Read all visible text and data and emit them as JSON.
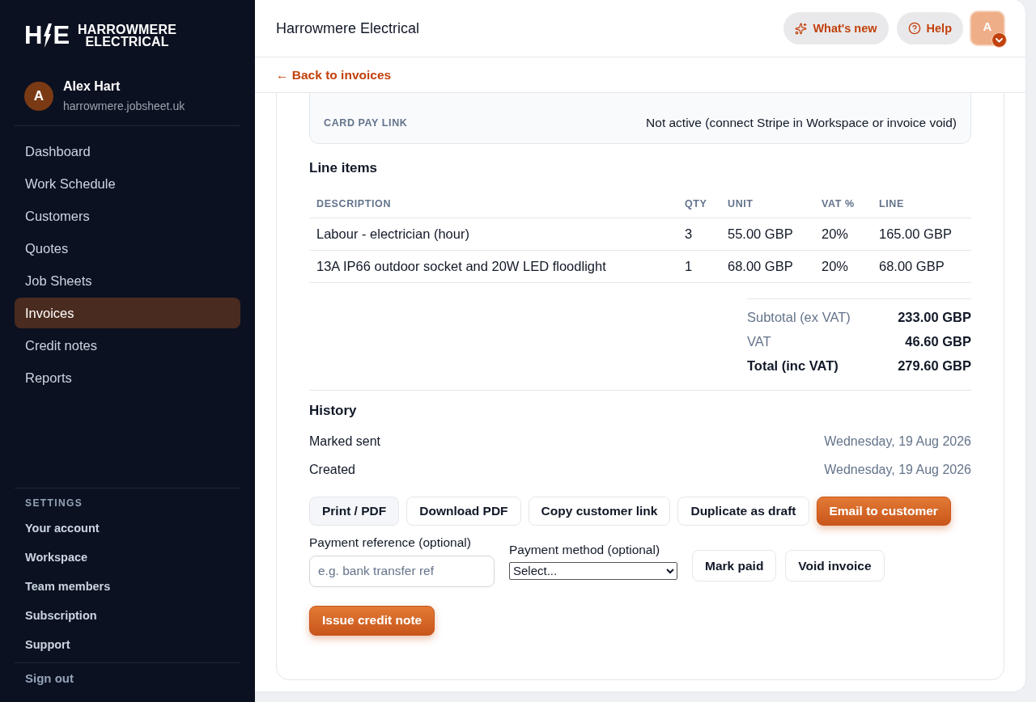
{
  "sidebar": {
    "logo": {
      "mark": [
        "H",
        "E"
      ],
      "wordmark": [
        "HARROWMERE",
        "ELECTRICAL"
      ]
    },
    "user": {
      "initial": "A",
      "name": "Alex Hart",
      "domain": "harrowmere.jobsheet.uk"
    },
    "nav": [
      {
        "label": "Dashboard",
        "selected": false
      },
      {
        "label": "Work Schedule",
        "selected": false
      },
      {
        "label": "Customers",
        "selected": false
      },
      {
        "label": "Quotes",
        "selected": false
      },
      {
        "label": "Job Sheets",
        "selected": false
      },
      {
        "label": "Invoices",
        "selected": true
      },
      {
        "label": "Credit notes",
        "selected": false
      },
      {
        "label": "Reports",
        "selected": false
      }
    ],
    "settings": {
      "heading": "SETTINGS",
      "items": [
        "Your account",
        "Workspace",
        "Team members",
        "Subscription",
        "Support"
      ]
    },
    "sign_out": "Sign out"
  },
  "header": {
    "title": "Harrowmere Electrical",
    "whats_new": "What's new",
    "help": "Help",
    "avatar_initial": "A"
  },
  "back_link": "← Back to invoices",
  "invoice": {
    "details": [
      {
        "label": "CARD PAY LINK",
        "value": "Not active (connect Stripe in Workspace or invoice void)"
      }
    ],
    "line_items": {
      "title": "Line items",
      "columns": [
        "DESCRIPTION",
        "QTY",
        "UNIT",
        "VAT %",
        "LINE"
      ],
      "rows": [
        [
          "Labour - electrician (hour)",
          "3",
          "55.00 GBP",
          "20%",
          "165.00 GBP"
        ],
        [
          "13A IP66 outdoor socket and 20W LED floodlight",
          "1",
          "68.00 GBP",
          "20%",
          "68.00 GBP"
        ]
      ]
    },
    "totals": [
      {
        "label": "Subtotal (ex VAT)",
        "value": "233.00 GBP",
        "kind": "sub"
      },
      {
        "label": "VAT",
        "value": "46.60 GBP",
        "kind": "sub"
      },
      {
        "label": "Total (inc VAT)",
        "value": "279.60 GBP",
        "kind": "grand"
      }
    ],
    "history": {
      "title": "History",
      "events": [
        {
          "label": "Marked sent",
          "date": "Wednesday, 19 Aug 2026"
        },
        {
          "label": "Created",
          "date": "Wednesday, 19 Aug 2026"
        }
      ]
    },
    "actions": [
      {
        "label": "Print / PDF",
        "kind": "secondary"
      },
      {
        "label": "Download PDF",
        "kind": "outline"
      },
      {
        "label": "Copy customer link",
        "kind": "outline"
      },
      {
        "label": "Duplicate as draft",
        "kind": "outline"
      },
      {
        "label": "Email to customer",
        "kind": "primary"
      }
    ],
    "payment": {
      "reference": {
        "label": "Payment reference (optional)",
        "placeholder": "e.g. bank transfer ref"
      },
      "method": {
        "label": "Payment method (optional)",
        "value": "Select..."
      },
      "buttons": [
        {
          "label": "Mark paid",
          "kind": "outline"
        },
        {
          "label": "Void invoice",
          "kind": "outline"
        }
      ]
    },
    "credit_note": {
      "label": "Issue credit note",
      "kind": "primary"
    }
  }
}
